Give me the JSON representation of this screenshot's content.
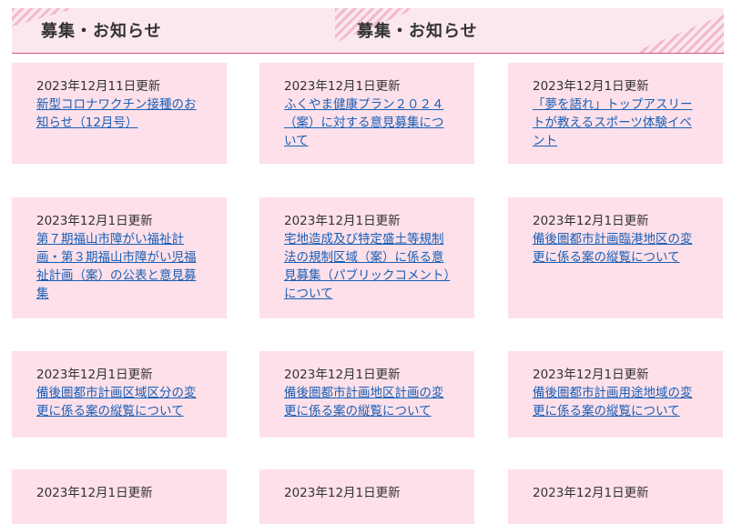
{
  "header": {
    "title_left": "募集・お知らせ",
    "title_right": "募集・お知らせ"
  },
  "cards": [
    {
      "date": "2023年12月11日更新",
      "title": "新型コロナワクチン接種のお知らせ（12月号）"
    },
    {
      "date": "2023年12月1日更新",
      "title": "ふくやま健康プラン２０２４（案）に対する意見募集について"
    },
    {
      "date": "2023年12月1日更新",
      "title": "「夢を語れ」トップアスリートが教えるスポーツ体験イベント"
    },
    {
      "date": "2023年12月1日更新",
      "title": "第７期福山市障がい福祉計画・第３期福山市障がい児福祉計画（案）の公表と意見募集"
    },
    {
      "date": "2023年12月1日更新",
      "title": "宅地造成及び特定盛土等規制法の規制区域（案）に係る意見募集（パブリックコメント）について"
    },
    {
      "date": "2023年12月1日更新",
      "title": "備後圏都市計画臨港地区の変更に係る案の縦覧について"
    },
    {
      "date": "2023年12月1日更新",
      "title": "備後圏都市計画区域区分の変更に係る案の縦覧について"
    },
    {
      "date": "2023年12月1日更新",
      "title": "備後圏都市計画地区計画の変更に係る案の縦覧について"
    },
    {
      "date": "2023年12月1日更新",
      "title": "備後圏都市計画用途地域の変更に係る案の縦覧について"
    },
    {
      "date": "2023年12月1日更新",
      "title": ""
    },
    {
      "date": "2023年12月1日更新",
      "title": ""
    },
    {
      "date": "2023年12月1日更新",
      "title": ""
    }
  ],
  "colors": {
    "card_bg": "#fde0ea",
    "header_bg": "#fbe8ee",
    "accent_line": "#d9577f",
    "link": "#1a5fb4"
  }
}
